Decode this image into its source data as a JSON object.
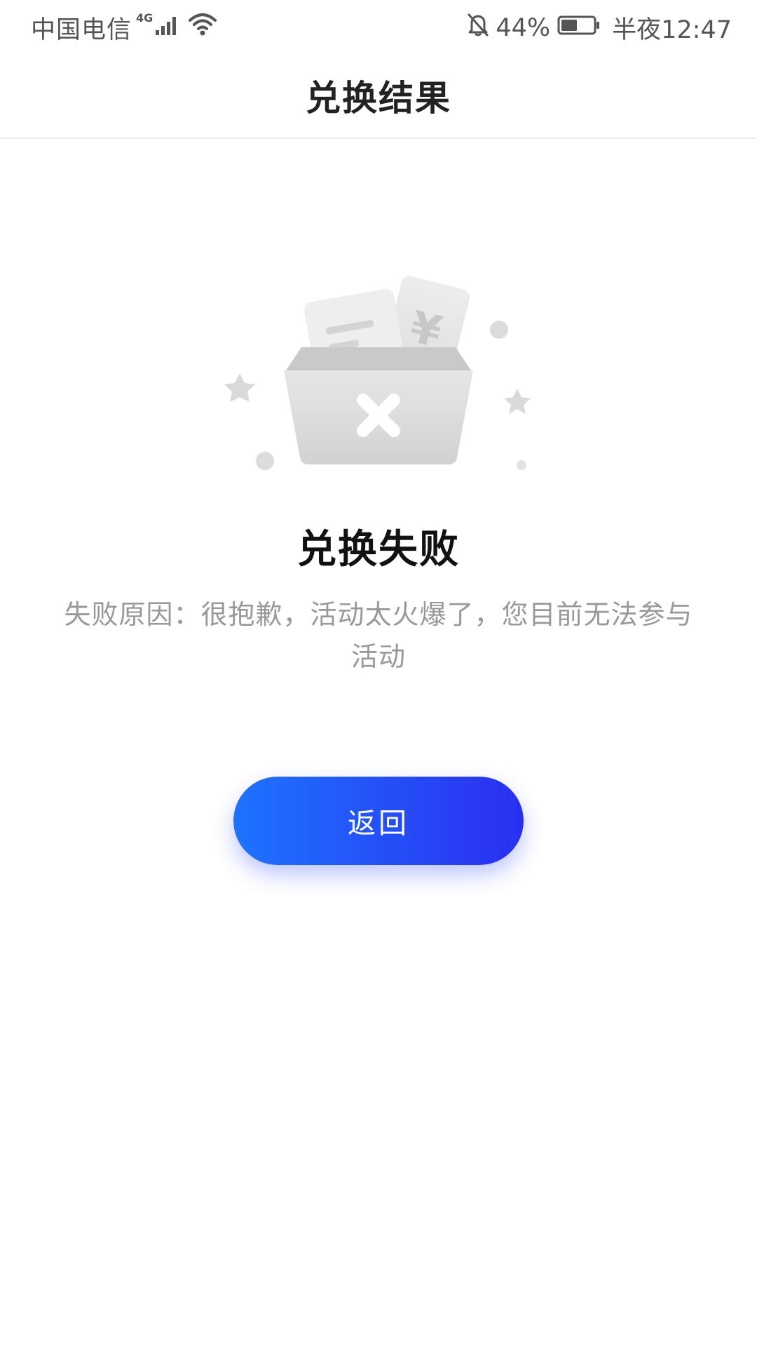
{
  "status_bar": {
    "carrier": "中国电信",
    "network_type": "4G",
    "battery_percent": "44%",
    "time": "半夜12:47",
    "icons": [
      "signal-icon",
      "wifi-icon",
      "bell-off-icon",
      "battery-icon"
    ]
  },
  "nav": {
    "title": "兑换结果"
  },
  "result": {
    "illustration_icon": "empty-box-failure-icon",
    "title": "兑换失败",
    "reason": "失败原因：很抱歉，活动太火爆了，您目前无法参与活动"
  },
  "actions": {
    "back_label": "返回"
  },
  "colors": {
    "button_gradient_start": "#1e73ff",
    "button_gradient_end": "#2a2ff0",
    "reason_text": "#999999"
  }
}
